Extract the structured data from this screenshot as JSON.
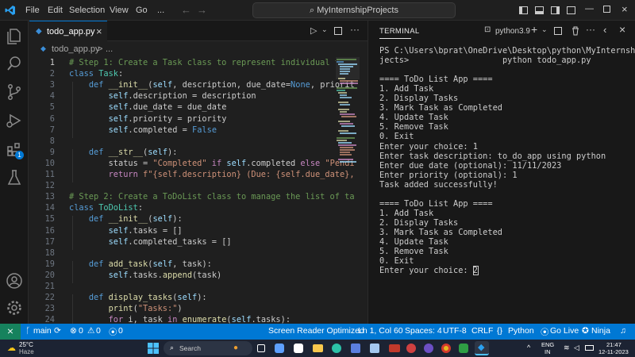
{
  "titlebar": {
    "menus": [
      "File",
      "Edit",
      "Selection",
      "View",
      "Go",
      "..."
    ],
    "command_center": "MyInternshipProjects",
    "nav_back_icon": "arrow-left-icon",
    "nav_forward_icon": "arrow-right-icon"
  },
  "activity_bar": {
    "items": [
      "explorer-icon",
      "search-icon",
      "source-control-icon",
      "run-debug-icon",
      "extensions-icon",
      "testing-icon"
    ],
    "extensions_badge": "1",
    "bottom": [
      "account-icon",
      "settings-gear-icon"
    ]
  },
  "editor": {
    "tab": {
      "label": "todo_app.py",
      "close": "×"
    },
    "breadcrumb": {
      "file": "todo_app.py",
      "sep": ">",
      "rest": "..."
    },
    "line_numbers": [
      "1",
      "2",
      "3",
      "4",
      "5",
      "6",
      "7",
      "8",
      "9",
      "10",
      "11",
      "12",
      "13",
      "14",
      "15",
      "16",
      "17",
      "18",
      "19",
      "20",
      "21",
      "22",
      "23",
      "24"
    ],
    "lines": [
      "# Step 1: Create a Task class to represent individual task",
      "class Task:",
      "    def __init__(self, description, due_date=None, priorit",
      "        self.description = description",
      "        self.due_date = due_date",
      "        self.priority = priority",
      "        self.completed = False",
      "",
      "    def __str__(self):",
      "        status = \"Completed\" if self.completed else \"Pendi",
      "        return f\"{self.description} (Due: {self.due_date},",
      "",
      "# Step 2: Create a ToDoList class to manage the list of ta",
      "class ToDoList:",
      "    def __init__(self):",
      "        self.tasks = []",
      "        self.completed_tasks = []",
      "",
      "    def add_task(self, task):",
      "        self.tasks.append(task)",
      "",
      "    def display_tasks(self):",
      "        print(\"Tasks:\")",
      "        for i, task in enumerate(self.tasks):"
    ]
  },
  "terminal": {
    "tab_label": "TERMINAL",
    "shell": "python3.9",
    "lines": [
      "PS C:\\Users\\bprat\\OneDrive\\Desktop\\python\\MyInternshipPro",
      "jects>                   python todo_app.py",
      "",
      "==== ToDo List App ====",
      "1. Add Task",
      "2. Display Tasks",
      "3. Mark Task as Completed",
      "4. Update Task",
      "5. Remove Task",
      "0. Exit",
      "Enter your choice: 1",
      "Enter task description: to_do_app using python",
      "Enter due date (optional): 11/11/2023",
      "Enter priority (optional): 1",
      "Task added successfully!",
      "",
      "==== ToDo List App ====",
      "1. Add Task",
      "2. Display Tasks",
      "3. Mark Task as Completed",
      "4. Update Task",
      "5. Remove Task",
      "0. Exit",
      "Enter your choice: 2"
    ]
  },
  "statusbar": {
    "remote": "⨯",
    "branch": "main",
    "sync": "⟳",
    "errors": "0",
    "warnings": "0",
    "ports": "0",
    "screen_reader": "Screen Reader Optimized",
    "position": "Ln 1, Col 60",
    "spaces": "Spaces: 4",
    "encoding": "UTF-8",
    "eol": "CRLF",
    "language": "Python",
    "golive": "Go Live",
    "ninja": "Ninja"
  },
  "taskbar": {
    "weather_temp": "25°C",
    "weather_desc": "Haze",
    "search_placeholder": "Search",
    "lang_top": "ENG",
    "lang_bottom": "IN",
    "time": "21:47",
    "date": "12-11-2023"
  },
  "colors": {
    "accent": "#0078d4",
    "status_bar": "#0078d4"
  }
}
